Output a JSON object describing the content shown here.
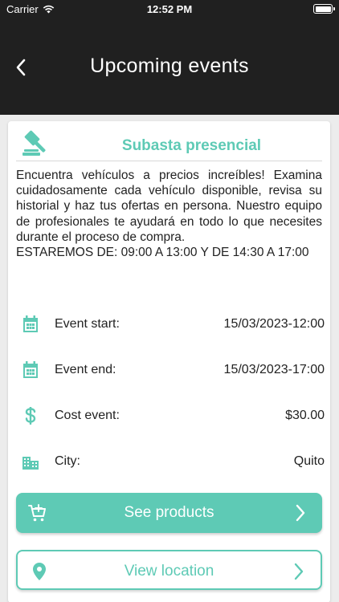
{
  "status_bar": {
    "carrier": "Carrier",
    "time": "12:52 PM"
  },
  "nav": {
    "title": "Upcoming events",
    "back_icon": "chevron-left-icon"
  },
  "event": {
    "title": "Subasta presencial",
    "description": "Encuentra vehículos a precios increíbles! Examina cuidadosamente cada vehículo disponible, revisa su historial y haz tus ofertas en persona. Nuestro equipo de profesionales te ayudará en todo lo que necesites durante el proceso de compra.",
    "schedule": "ESTAREMOS DE: 09:00 A 13:00 Y DE 14:30 A 17:00",
    "details": [
      {
        "icon": "calendar-icon",
        "label": "Event start:",
        "value": "15/03/2023-12:00"
      },
      {
        "icon": "calendar-icon",
        "label": "Event end:",
        "value": "15/03/2023-17:00"
      },
      {
        "icon": "dollar-icon",
        "label": "Cost event:",
        "value": "$30.00"
      },
      {
        "icon": "city-icon",
        "label": "City:",
        "value": "Quito"
      }
    ]
  },
  "buttons": {
    "products_label": "See products",
    "location_label": "View location"
  },
  "colors": {
    "accent": "#5ecab5",
    "nav_background": "#202020",
    "page_background": "#ececec"
  }
}
